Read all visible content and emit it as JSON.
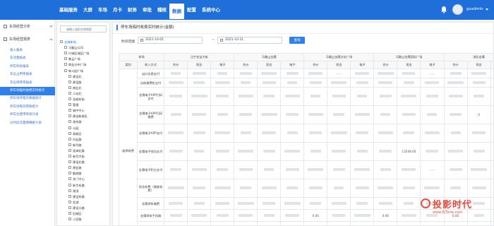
{
  "nav": {
    "menu": [
      "基础服务",
      "大屏",
      "车场",
      "月卡",
      "财务",
      "审批",
      "稽核",
      "数据",
      "配置",
      "系统中心"
    ],
    "active_index": 7,
    "user": "gsadmin"
  },
  "sidebar": {
    "group_collapsed": "车场经营分析",
    "group_expanded": "车场经营报表",
    "items": [
      "收入报表",
      "车流量报表",
      "停车时段报表",
      "车位占用率报表",
      "车位周转率报表",
      "停车场临时收费实时统计",
      "停车场月租车数据统计",
      "停车场每日营收统计",
      "停车位使用率统计表",
      "分时段流量明细统计表"
    ],
    "active_index": 5
  },
  "tree": {
    "search_placeholder": "请输入组织名称搜索",
    "nodes": [
      "全城车场",
      "马鞍山公司",
      "兴城区城区广场",
      "紫云广场",
      "商业分布广场",
      "新公园广场",
      "建设北",
      "建设路",
      "商业北",
      "二站北",
      "金顺东街",
      "管理",
      "城中中心",
      "建设新旅区",
      "湖东路",
      "公园",
      "高新区",
      "内业路",
      "新华路",
      "淮海北路",
      "新华大街",
      "建设北路",
      "建业路",
      "解放路",
      "东门中心",
      "新华东路",
      "湖滨",
      "建设东路",
      "北湖",
      "建设公路",
      "旧城区",
      "人民路"
    ]
  },
  "page": {
    "title": "停车场临时收费实时统计(金额)",
    "time_label": "时间范围",
    "date_start": "2021-10-01",
    "date_end": "2021-10-31",
    "date_sep": "~",
    "query_label": "查询"
  },
  "table": {
    "lot_label": "车场",
    "type_label": "类别",
    "method_label": "收入方式",
    "lots": [
      "江宁金宝大街",
      "马鞍山金鹰",
      "马鞍山金鹰文化广场",
      "马鞍山金鹰国际广场",
      "淮北金鹰",
      "建"
    ],
    "sub_headers": [
      "合计",
      "现金",
      "电子"
    ],
    "category": "临停收费",
    "rows": [
      {
        "method": "出口无感支付",
        "vals": [
          [
            "",
            "",
            ""
          ],
          [
            "",
            "",
            ""
          ],
          [
            "",
            "- - -",
            ""
          ],
          [
            "",
            "",
            "- - -"
          ],
          [
            "",
            "",
            ""
          ]
        ]
      },
      {
        "method": "自助缴费机支付",
        "vals": [
          [
            "",
            "",
            ""
          ],
          [
            "",
            "",
            ""
          ],
          [
            "",
            "",
            ""
          ],
          [
            "",
            "",
            ""
          ],
          [
            "",
            "",
            ""
          ]
        ]
      },
      {
        "method": "金鹰电子APP扫码支付",
        "vals": [
          [
            "",
            "",
            ""
          ],
          [
            "",
            "",
            ""
          ],
          [
            "",
            "",
            ""
          ],
          [
            "",
            "",
            ""
          ],
          [
            "",
            "",
            "."
          ]
        ]
      },
      {
        "method": "金鹰电子APP扫码缴费",
        "vals": [
          [
            "",
            "",
            ""
          ],
          [
            "",
            "",
            ""
          ],
          [
            "",
            "",
            ""
          ],
          [
            "",
            "",
            ""
          ],
          [
            "",
            "0",
            ""
          ]
        ]
      },
      {
        "method": "金鹰电子APP支付",
        "vals": [
          [
            "",
            "",
            ""
          ],
          [
            "",
            "",
            ""
          ],
          [
            "",
            "",
            ""
          ],
          [
            "",
            "",
            ""
          ],
          [
            "",
            "",
            ""
          ]
        ]
      },
      {
        "method": "金鹰电子钱包支付",
        "vals": [
          [
            "",
            "",
            ""
          ],
          [
            "",
            "",
            ""
          ],
          [
            "",
            "",
            ""
          ],
          [
            "",
            "13248.00",
            ""
          ],
          [
            "",
            "",
            ""
          ]
        ]
      },
      {
        "method": "金鹰电子积分支付",
        "vals": [
          [
            "",
            "",
            ""
          ],
          [
            "",
            "",
            ""
          ],
          [
            "",
            "",
            ""
          ],
          [
            "",
            "",
            "- - -"
          ],
          [
            "",
            "",
            ""
          ]
        ]
      },
      {
        "method": "现金收费（稽查收费）",
        "vals": [
          [
            "",
            "",
            ""
          ],
          [
            "",
            "",
            ""
          ],
          [
            "",
            "",
            ""
          ],
          [
            "",
            "",
            ""
          ],
          [
            "",
            "",
            ""
          ]
        ]
      },
      {
        "method": "金鹰停车缴费",
        "vals": [
          [
            "",
            "",
            ""
          ],
          [
            "",
            "",
            ""
          ],
          [
            "",
            "",
            ""
          ],
          [
            "",
            "",
            ""
          ],
          [
            "",
            "",
            ""
          ]
        ]
      },
      {
        "method": "金鹰停车手机端",
        "vals": [
          [
            "",
            "",
            ""
          ],
          [
            "",
            "",
            ""
          ],
          [
            "0.00",
            "",
            ""
          ],
          [
            "0.00",
            "",
            ""
          ],
          [
            "0.00",
            "",
            ""
          ]
        ]
      },
      {
        "method": "金鹰电子扫码支付",
        "vals": [
          [
            "",
            "",
            ""
          ],
          [
            "",
            "",
            ""
          ],
          [
            "0.00",
            "",
            ""
          ],
          [
            "0.00",
            "",
            ""
          ],
          [
            "0.00",
            "",
            ""
          ]
        ]
      }
    ]
  },
  "watermark": {
    "text": "投影时代",
    "url": "www.PjTime.com"
  }
}
